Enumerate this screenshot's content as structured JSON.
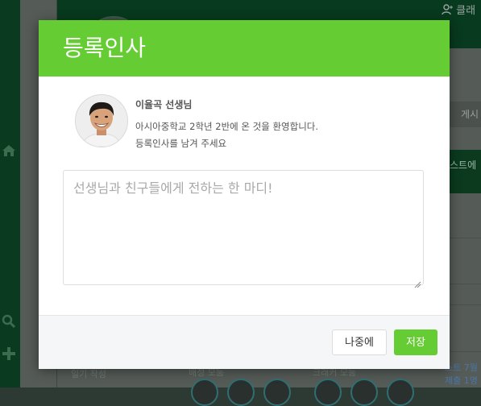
{
  "background": {
    "top_right_text": "클래",
    "tab_text": "게시",
    "band_text": "스트에",
    "bottom_left_text": "일기 작성",
    "bottom_mid1": "배정 모둠",
    "bottom_mid2": "크래커 모둠",
    "bottom_right_1": "스트 7월",
    "bottom_right_2": "제출 1명"
  },
  "modal": {
    "title": "등록인사",
    "teacher_name": "이율곡 선생님",
    "welcome_line_1": "아시아중학교 2학년 2반에 온 것을 환영합니다.",
    "welcome_line_2": "등록인사를 남겨 주세요",
    "message_input": {
      "placeholder": "선생님과 친구들에게 전하는 한 마디!",
      "value": ""
    },
    "buttons": {
      "later_label": "나중에",
      "save_label": "저장"
    }
  },
  "colors": {
    "accent": "#66cc33",
    "sidebar": "#0a3a1f",
    "header": "#073a1f"
  },
  "icons": [
    "home-icon",
    "search-icon",
    "plus-icon",
    "add-user-icon",
    "user-photo"
  ]
}
